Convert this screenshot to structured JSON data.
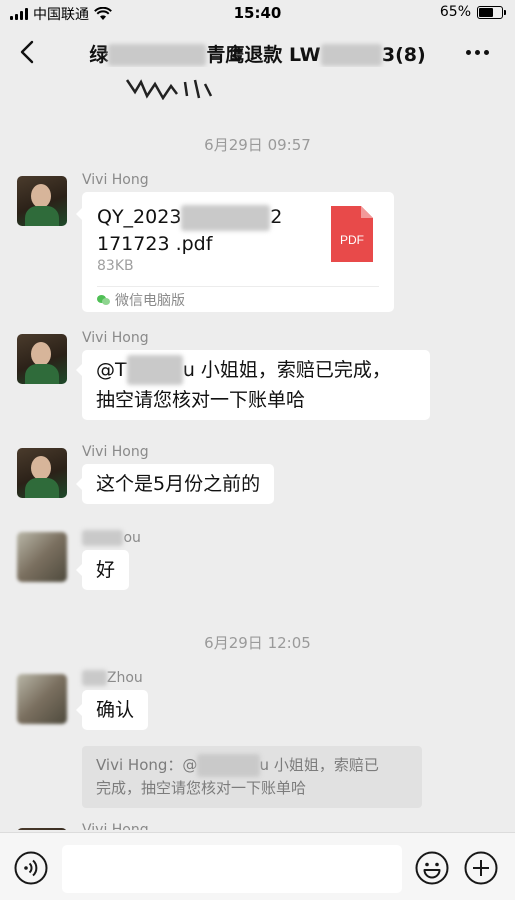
{
  "status_bar": {
    "carrier": "中国联通",
    "time": "15:40",
    "battery_percent_label": "65%",
    "battery_level": 0.65
  },
  "nav": {
    "title_prefix": "绿",
    "title_mid": "青鹰退款 LW",
    "title_suffix": "3(8)",
    "back_icon": "chevron-left-icon",
    "more_icon": "ellipsis-icon"
  },
  "chat": {
    "timestamps": [
      "6月29日 09:57",
      "6月29日 12:05"
    ],
    "messages": [
      {
        "sender": "Vivi Hong",
        "type": "file",
        "file_name_start": "QY_2023",
        "file_name_end": "2",
        "file_name_line2": "171723 .pdf",
        "file_size": "83KB",
        "file_type_label": "PDF",
        "file_source": "微信电脑版"
      },
      {
        "sender": "Vivi Hong",
        "type": "text",
        "mention_prefix": "@T",
        "mention_suffix": "u 小姐姐，索赔已完成，",
        "line2": "抽空请您核对一下账单哈"
      },
      {
        "sender": "Vivi Hong",
        "type": "text",
        "text": "这个是5月份之前的"
      },
      {
        "sender_suffix": "ou",
        "type": "text",
        "text": "好"
      },
      {
        "sender_suffix": "Zhou",
        "type": "text",
        "text": "确认",
        "quote_line1_prefix": "Vivi Hong：@",
        "quote_line1_suffix": "u 小姐姐，索赔已",
        "quote_line2": "完成，抽空请您核对一下账单哈"
      },
      {
        "sender": "Vivi Hong",
        "type": "partial"
      }
    ]
  },
  "input_bar": {
    "voice_icon": "voice-icon",
    "emoji_icon": "emoji-icon",
    "plus_icon": "plus-icon",
    "placeholder": ""
  },
  "colors": {
    "background": "#ededed",
    "bubble": "#ffffff",
    "pdf_red": "#e84a4a",
    "wechat_green": "#4fbf55"
  }
}
